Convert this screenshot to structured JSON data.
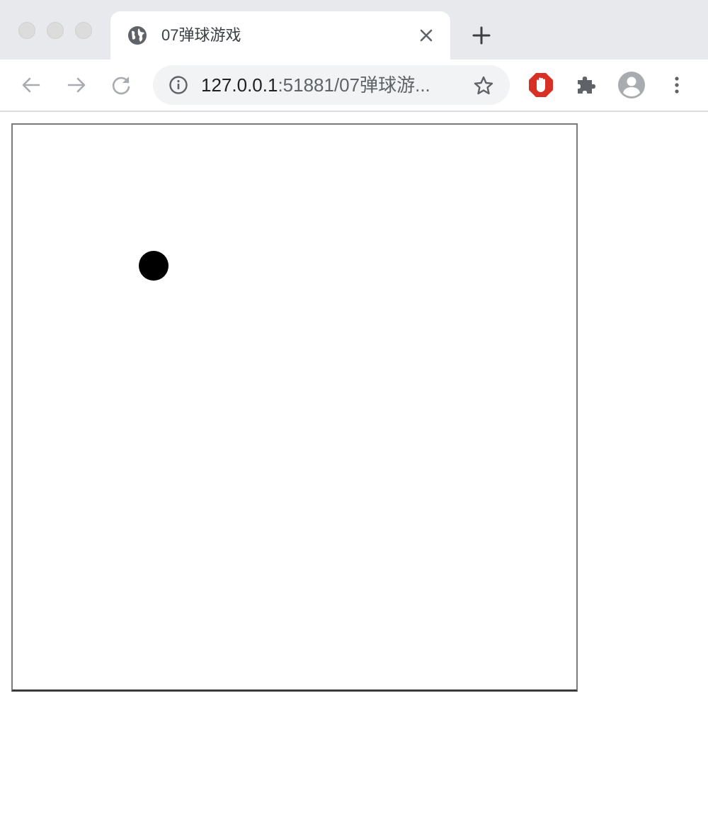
{
  "tab": {
    "title": "07弹球游戏"
  },
  "address_bar": {
    "url_host": "127.0.0.1",
    "url_rest": ":51881/07弹球游..."
  },
  "icons": {
    "favicon": "globe-icon",
    "close": "close-icon",
    "new_tab": "plus-icon",
    "back": "back-arrow-icon",
    "forward": "forward-arrow-icon",
    "reload": "reload-icon",
    "site_info": "info-icon",
    "bookmark": "star-icon",
    "adblock": "adblock-stop-hand-icon",
    "extensions": "puzzle-icon",
    "profile": "profile-avatar-icon",
    "menu": "kebab-menu-icon"
  },
  "colors": {
    "tabstrip_bg": "#e8e9ec",
    "omnibox_bg": "#f1f3f4",
    "adblock_red": "#d93025",
    "ball": "#000000",
    "canvas_border": "#7a7a7a"
  }
}
